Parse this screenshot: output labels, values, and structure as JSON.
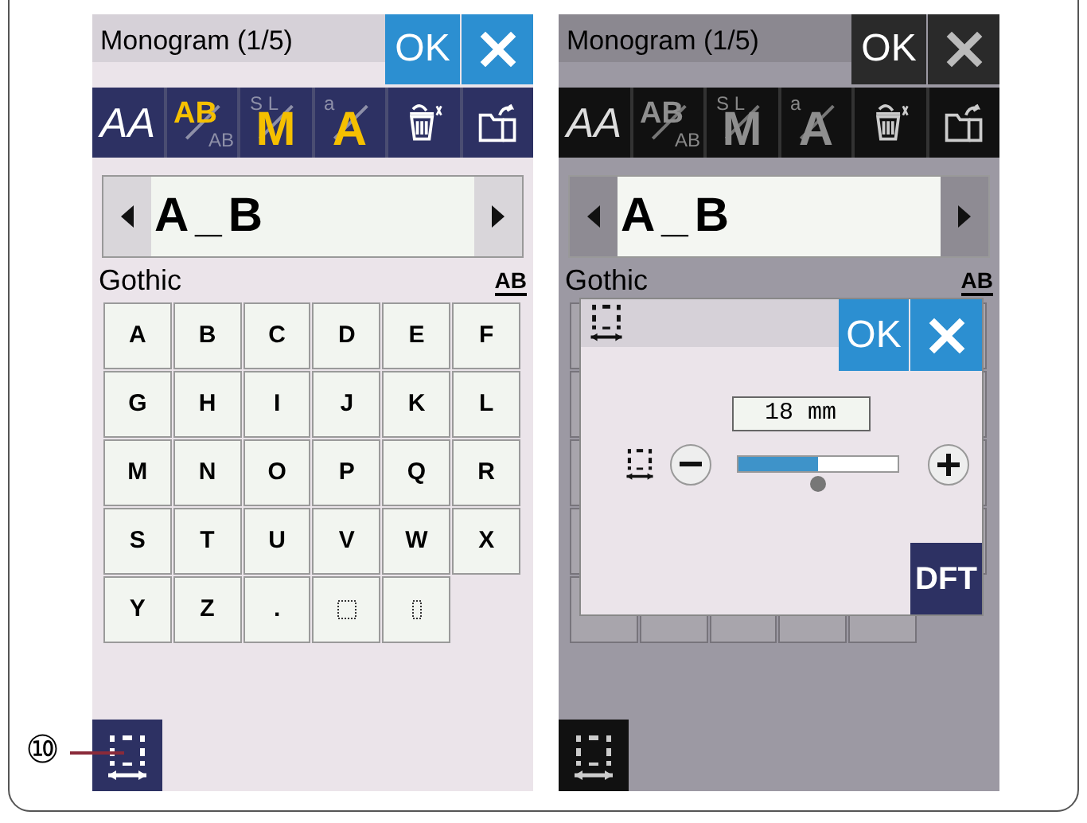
{
  "callout": {
    "label": "⑩"
  },
  "screens": [
    {
      "dimmed": false,
      "title": "Monogram (1/5)",
      "ok": "OK",
      "toolbar": [
        {
          "kind": "style",
          "label": "AA"
        },
        {
          "kind": "case",
          "label": "AB",
          "sub": "AB",
          "active": true
        },
        {
          "kind": "size",
          "label": "M",
          "sub": "S L",
          "active": true
        },
        {
          "kind": "lowercase",
          "label": "A",
          "sub": "a",
          "active": true
        },
        {
          "kind": "delete"
        },
        {
          "kind": "open"
        }
      ],
      "text_field": {
        "value": "A_B"
      },
      "font": "Gothic",
      "case_label": "AB",
      "keys": [
        {
          "kind": "char",
          "label": "A"
        },
        {
          "kind": "char",
          "label": "B"
        },
        {
          "kind": "char",
          "label": "C"
        },
        {
          "kind": "char",
          "label": "D"
        },
        {
          "kind": "char",
          "label": "E"
        },
        {
          "kind": "char",
          "label": "F"
        },
        {
          "kind": "char",
          "label": "G"
        },
        {
          "kind": "char",
          "label": "H"
        },
        {
          "kind": "char",
          "label": "I"
        },
        {
          "kind": "char",
          "label": "J"
        },
        {
          "kind": "char",
          "label": "K"
        },
        {
          "kind": "char",
          "label": "L"
        },
        {
          "kind": "char",
          "label": "M"
        },
        {
          "kind": "char",
          "label": "N"
        },
        {
          "kind": "char",
          "label": "O"
        },
        {
          "kind": "char",
          "label": "P"
        },
        {
          "kind": "char",
          "label": "Q"
        },
        {
          "kind": "char",
          "label": "R"
        },
        {
          "kind": "char",
          "label": "S"
        },
        {
          "kind": "char",
          "label": "T"
        },
        {
          "kind": "char",
          "label": "U"
        },
        {
          "kind": "char",
          "label": "V"
        },
        {
          "kind": "char",
          "label": "W"
        },
        {
          "kind": "char",
          "label": "X"
        },
        {
          "kind": "char",
          "label": "Y"
        },
        {
          "kind": "char",
          "label": "Z"
        },
        {
          "kind": "char",
          "label": "."
        },
        {
          "kind": "space-wide"
        },
        {
          "kind": "space-narrow"
        }
      ]
    },
    {
      "dimmed": true,
      "title": "Monogram (1/5)",
      "ok": "OK",
      "toolbar": [
        {
          "kind": "style",
          "label": "AA"
        },
        {
          "kind": "case",
          "label": "AB",
          "sub": "AB",
          "active": false
        },
        {
          "kind": "size",
          "label": "M",
          "sub": "S L",
          "active": false
        },
        {
          "kind": "lowercase",
          "label": "A",
          "sub": "a",
          "active": false
        },
        {
          "kind": "delete"
        },
        {
          "kind": "open"
        }
      ],
      "text_field": {
        "value": "A_B"
      },
      "font": "Gothic",
      "case_label": "AB",
      "dialog": {
        "ok": "OK",
        "value": "18 mm",
        "level": 0.5,
        "default": "DFT"
      }
    }
  ]
}
